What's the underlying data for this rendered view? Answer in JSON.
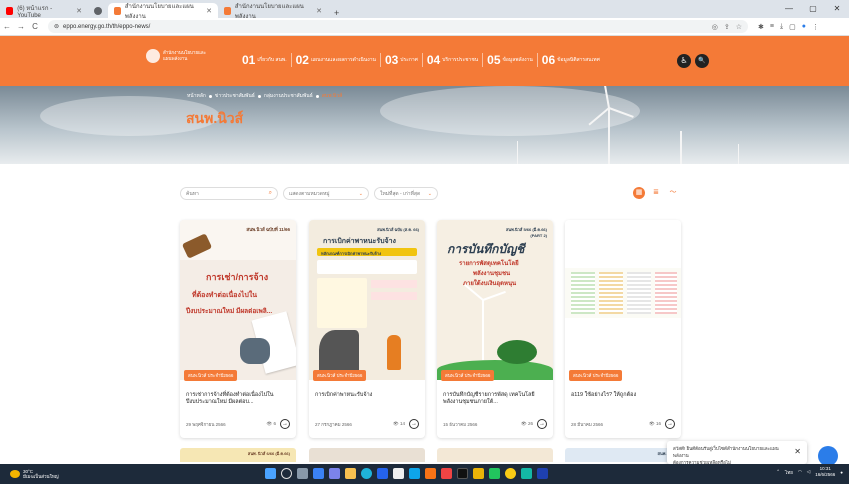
{
  "browser": {
    "tabs": [
      {
        "label": "(6) หน้าแรก - YouTube",
        "color": "#ff0000",
        "active": false
      },
      {
        "label": "สำนักงานนโยบายและแผนพลังงาน",
        "color": "#f47a37",
        "active": true
      },
      {
        "label": "สำนักงานนโยบายและแผนพลังงาน",
        "color": "#f47a37",
        "active": false
      }
    ],
    "new_tab": "+",
    "url": "eppo.energy.go.th/th/eppo-news/",
    "win_min": "—",
    "win_max": "▢",
    "win_close": "✕"
  },
  "header": {
    "logo_line1": "สำนักงานนโยบายและ",
    "logo_line2": "แผนพลังงาน",
    "menu": [
      {
        "num": "01",
        "label": "เกี่ยวกับ สนพ."
      },
      {
        "num": "02",
        "label": "แผนงานและผลการดำเนินงาน"
      },
      {
        "num": "03",
        "label": "ประกาศ"
      },
      {
        "num": "04",
        "label": "บริการประชาชน"
      },
      {
        "num": "05",
        "label": "ข้อมูลพลังงาน"
      },
      {
        "num": "06",
        "label": "ข้อมูลนิติสารสนเทศ"
      }
    ],
    "accessibility_glyph": "♿",
    "search_glyph": "🔍"
  },
  "hero": {
    "breadcrumb": [
      "หน้าหลัก",
      "ข่าวประชาสัมพันธ์",
      "กลุ่มงานประชาสัมพันธ์",
      "สนพ.นิวส์"
    ],
    "title": "สนพ.นิวส์"
  },
  "filters": {
    "search_placeholder": "ค้นหา",
    "category": "แสดงตามหมวดหมู่",
    "sort": "ใหม่ที่สุด - เก่าที่สุด"
  },
  "cards": [
    {
      "badge": "สนพ.นิวส์ ประจำปี2566",
      "title": "การเช่าการจ้างที่ต้องทำต่อเนื่องไปในปีงบประมาณใหม่ มีผลต่อบ...",
      "date": "29 พฤศจิกายน 2566",
      "views": "6",
      "thumb_header": "สนพ.นิวส์ ฉบับที่ 11/66",
      "thumb_lines": [
        "การเช่า/การจ้าง",
        "ที่ต้องทำต่อเนื่องไปใน",
        "ปีงบประมาณใหม่ มีผลต่อเพลิ..."
      ]
    },
    {
      "badge": "สนพ.นิวส์ ประจำปี2566",
      "title": "การเบิกค่าพาหนะรับจ้าง",
      "date": "27 กรกฎาคม 2566",
      "views": "14",
      "thumb_header": "สนพ.นิวส์ ฉบับ (ส.ค. 66)",
      "thumb_lines": [
        "การเบิกค่าพาหนะรับจ้าง",
        "หลักเกณฑ์การเบิกค่าพาหนะรับจ้าง"
      ]
    },
    {
      "badge": "สนพ.นิวส์ ประจำปี2566",
      "title": "การบันทึกบัญชีรายการพัสดุ เทคโนโลยีพลังงานชุมชนภายใต้...",
      "date": "15 ธันวาคม 2566",
      "views": "26",
      "thumb_header": "สนพ.นิวส์ 5/66 (มี.ค.66) (PART 2)",
      "thumb_lines": [
        "การบันทึกบัญชี",
        "รายการพัสดุเทคโนโลยี",
        "พลังงานชุมชน",
        "ภายใต้งบเงินอุดหนุน"
      ]
    },
    {
      "badge": "สนพ.นิวส์ ประจำปี2566",
      "title": "อ119 ใช้อย่างไร? ให้ถูกต้อง",
      "date": "28 มีนาคม 2566",
      "views": "16",
      "thumb_header": "",
      "thumb_lines": []
    }
  ],
  "bottom_cards": [
    {
      "label": "สนพ. นิวส์ 6/66 (มี.ค.66)"
    },
    {
      "label": ""
    },
    {
      "label": ""
    },
    {
      "label": "สนพ. นิวส์"
    }
  ],
  "popup": {
    "line1": "สวัสดี! ยินดีต้อนรับสู่เว็บไซต์สำนักงานนโยบายและแผนพลังงาน",
    "line2": "ต้องการความช่วยเหลือหรือไม่",
    "close": "✕"
  },
  "taskbar": {
    "temp": "30°C",
    "weather": "มีเมฆเป็นส่วนใหญ่",
    "time": "10:31",
    "date": "16/6/2566",
    "lang": "ไทย"
  },
  "colors": {
    "accent": "#f47a37",
    "taskbar": "#1d2a3a"
  }
}
